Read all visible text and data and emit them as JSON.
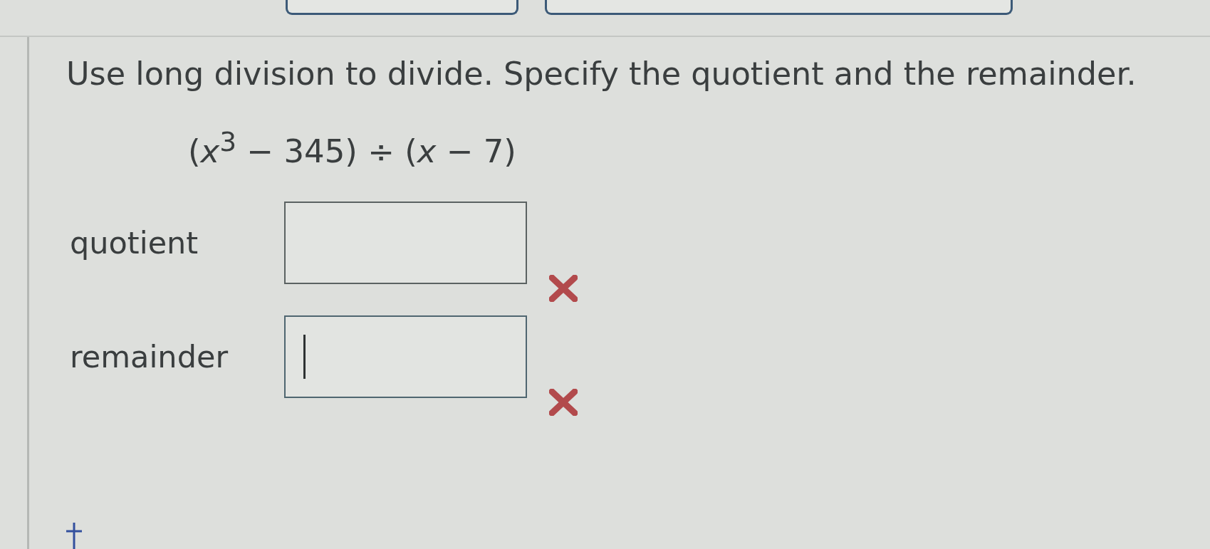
{
  "question": {
    "prompt": "Use long division to divide. Specify the quotient and the remainder.",
    "expression": "(*x*$^{3}$ − 345) ÷ (*x* − 7)"
  },
  "answers": [
    {
      "label": "quotient",
      "focused": false,
      "correct": false
    },
    {
      "label": "remainder",
      "focused": true,
      "correct": false
    }
  ]
}
